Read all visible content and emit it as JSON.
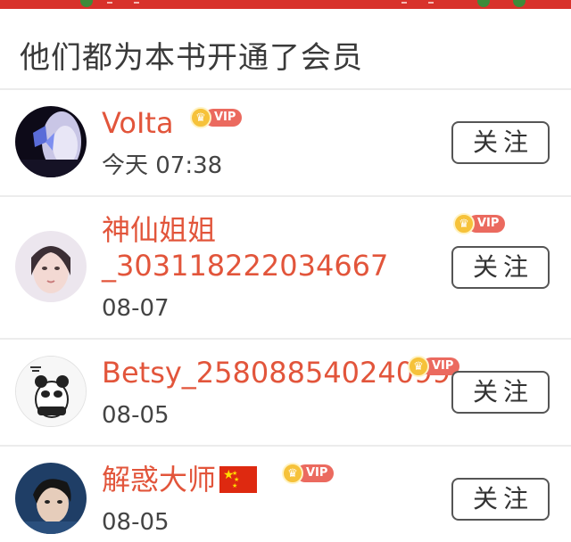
{
  "header": {
    "title": "他们都为本书开通了会员"
  },
  "colors": {
    "accent": "#e2553b",
    "banner": "#d8322b",
    "vip_tag": "#eb6a5f",
    "vip_crown": "#f6c23a"
  },
  "vip_label": "VIP",
  "follow_label": "关注",
  "members": [
    {
      "name_line1": "VoIta",
      "name_line2": "",
      "time": "今天 07:38",
      "vip": true,
      "avatar_icon": "avatar-butterfly-portrait"
    },
    {
      "name_line1": "神仙姐姐",
      "name_line2": "_303118222034667",
      "time": "08-07",
      "vip": true,
      "avatar_icon": "avatar-woman-portrait"
    },
    {
      "name_line1": "Betsy_25808854024099",
      "name_line2": "",
      "time": "08-05",
      "vip": true,
      "avatar_icon": "avatar-panda-sticker"
    },
    {
      "name_line1": "解惑大师",
      "name_line2": "",
      "time": "08-05",
      "vip": true,
      "avatar_icon": "avatar-man-portrait",
      "flag": "china-flag"
    }
  ]
}
